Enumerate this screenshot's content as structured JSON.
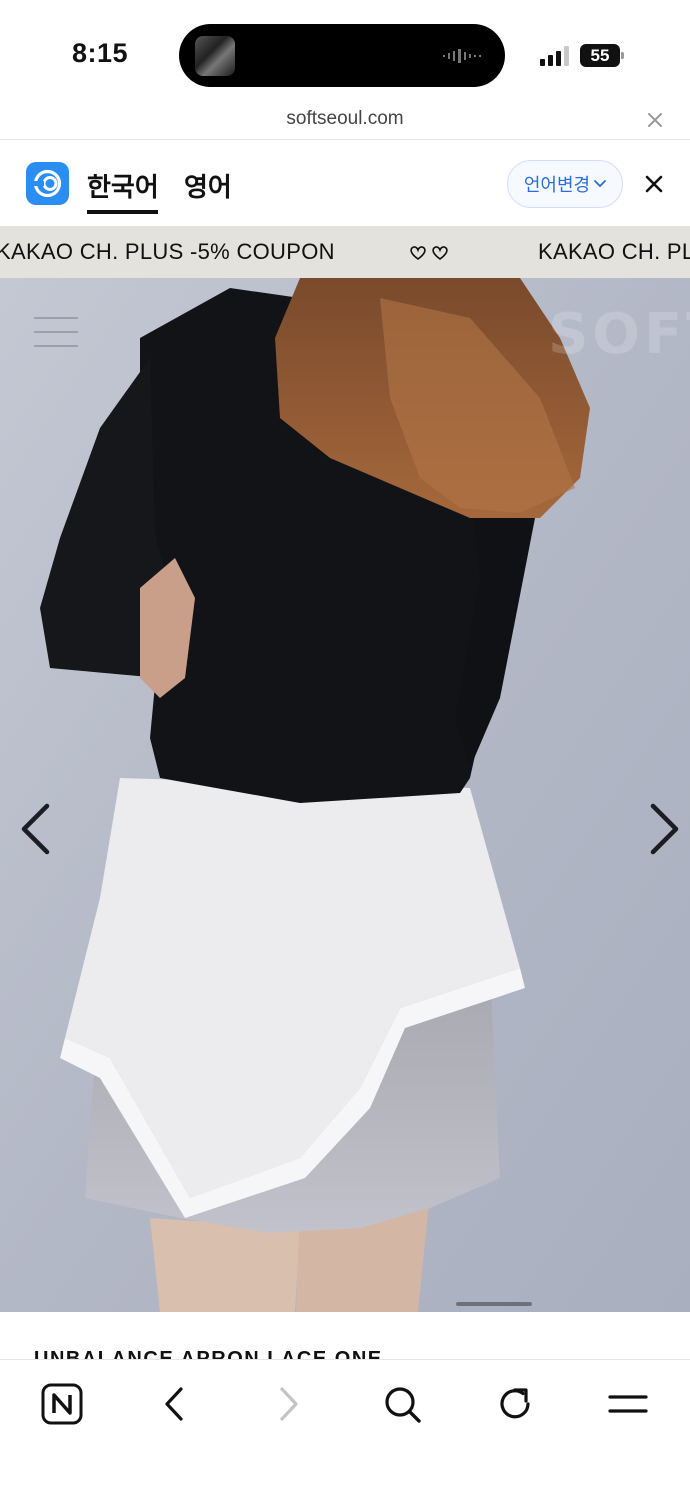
{
  "status_bar": {
    "time": "8:15",
    "battery": "55",
    "icons": [
      "now-playing-art",
      "audio-wave-icon",
      "signal-icon",
      "battery-icon"
    ]
  },
  "browser": {
    "url": "softseoul.com",
    "close_icon": "close-icon"
  },
  "translate_bar": {
    "tabs": [
      {
        "label": "한국어",
        "selected": true
      },
      {
        "label": "영어",
        "selected": false
      }
    ],
    "change_language_label": "언어변경",
    "icons": [
      "translate-logo-icon",
      "chevron-down-icon",
      "close-icon"
    ],
    "accent": "#2a8df2"
  },
  "banner": {
    "text_1": "KAKAO CH. PLUS -5% COUPON",
    "text_2": "KAKAO CH. PL",
    "separator_icon": "hearts-icon",
    "background": "#e4e2dc"
  },
  "hero": {
    "logo_text": "SOFT",
    "icons": [
      "hamburger-menu-icon",
      "chevron-left-icon",
      "chevron-right-icon"
    ]
  },
  "product": {
    "title": "UNBALANCE APRON LACE ONE"
  },
  "toolbar": {
    "icons": [
      "naver-n-icon",
      "back-icon",
      "forward-icon",
      "search-icon",
      "refresh-icon",
      "menu-icon"
    ]
  }
}
